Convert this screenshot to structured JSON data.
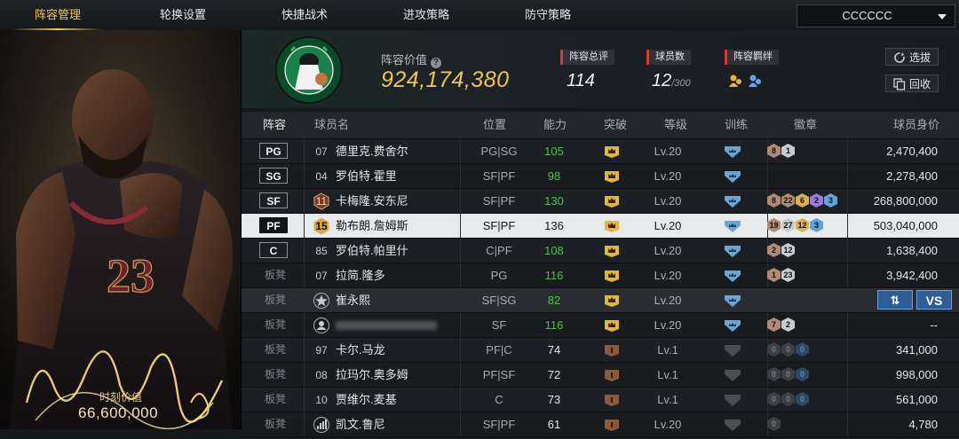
{
  "nav": {
    "tabs": [
      "阵容管理",
      "轮换设置",
      "快捷战术",
      "进攻策略",
      "防守策略"
    ],
    "active_tab": 0,
    "team_select": "CCCCCC"
  },
  "card": {
    "signature_label": "时刻价值",
    "signature_value": "66,600,000",
    "jersey_number": "23"
  },
  "summary": {
    "value_label": "阵容价值",
    "value": "924,174,380",
    "rating_label": "阵容总评",
    "rating": "114",
    "count_label": "球员数",
    "count": "12",
    "count_max": "/300",
    "bond_label": "阵容羁绊",
    "select_button": "选拔",
    "recycle_button": "回收"
  },
  "table": {
    "headers": [
      "阵容",
      "球员名",
      "位置",
      "能力",
      "突破",
      "等级",
      "训练",
      "徽章",
      "球员身价"
    ],
    "rows": [
      {
        "slot": "PG",
        "slot_type": "starter",
        "num": "07",
        "num_style": "plain",
        "name": "德里克.费舍尔",
        "pos": "PG|SG",
        "ability": "105",
        "green": true,
        "break": "gold",
        "level": "Lv.20",
        "train": "blue",
        "badges": [
          {
            "t": "bronze",
            "v": "8"
          },
          {
            "t": "silver",
            "v": "1"
          }
        ],
        "price": "2,470,400"
      },
      {
        "slot": "SG",
        "slot_type": "starter",
        "num": "04",
        "num_style": "plain",
        "name": "罗伯特.霍里",
        "pos": "SF|PF",
        "ability": "98",
        "green": true,
        "break": "gold",
        "level": "Lv.20",
        "train": "blue",
        "badges": [],
        "price": "2,278,400"
      },
      {
        "slot": "SF",
        "slot_type": "starter",
        "num": "11",
        "num_style": "hex",
        "name": "卡梅隆.安东尼",
        "pos": "SF|PF",
        "ability": "130",
        "green": true,
        "break": "gold",
        "level": "Lv.20",
        "train": "blue",
        "badges": [
          {
            "t": "bronze",
            "v": "8"
          },
          {
            "t": "bronze",
            "v": "22"
          },
          {
            "t": "gold",
            "v": "6"
          },
          {
            "t": "purple",
            "v": "2"
          },
          {
            "t": "blue",
            "v": "3"
          }
        ],
        "price": "268,800,000"
      },
      {
        "slot": "PF",
        "slot_type": "starter",
        "num": "15",
        "num_style": "hexgold",
        "name": "勒布朗.詹姆斯",
        "pos": "SF|PF",
        "ability": "136",
        "green": false,
        "break": "gold",
        "level": "Lv.20",
        "train": "blue",
        "badges": [
          {
            "t": "bronze",
            "v": "19"
          },
          {
            "t": "silver",
            "v": "27"
          },
          {
            "t": "gold",
            "v": "12"
          },
          {
            "t": "blue",
            "v": "3"
          }
        ],
        "price": "503,040,000",
        "selected": true
      },
      {
        "slot": "C",
        "slot_type": "starter",
        "num": "85",
        "num_style": "plain",
        "name": "罗伯特.帕里什",
        "pos": "C|PF",
        "ability": "108",
        "green": true,
        "break": "gold",
        "level": "Lv.20",
        "train": "blue",
        "badges": [
          {
            "t": "bronze",
            "v": "2"
          },
          {
            "t": "silver",
            "v": "12"
          }
        ],
        "price": "1,638,400"
      },
      {
        "slot": "板凳",
        "slot_type": "bench",
        "num": "07",
        "num_style": "plain",
        "name": "拉简.隆多",
        "pos": "PG",
        "ability": "116",
        "green": true,
        "break": "gold",
        "level": "Lv.20",
        "train": "blue",
        "badges": [
          {
            "t": "bronze",
            "v": "1"
          },
          {
            "t": "silver",
            "v": "23"
          }
        ],
        "price": "3,942,400"
      },
      {
        "slot": "板凳",
        "slot_type": "bench",
        "num": "★",
        "num_style": "star",
        "name": "崔永熙",
        "pos": "SF|SG",
        "ability": "82",
        "green": true,
        "break": "gold",
        "level": "Lv.20",
        "train": "blue",
        "badges": [],
        "price": "",
        "highlight": true,
        "swap_button": "⇅",
        "vs_button": "VS"
      },
      {
        "slot": "板凳",
        "slot_type": "bench",
        "num": "",
        "num_style": "person",
        "name": "",
        "blurred": true,
        "pos": "SF",
        "ability": "116",
        "green": true,
        "break": "gold",
        "level": "Lv.20",
        "train": "blue",
        "badges": [
          {
            "t": "bronze",
            "v": "7"
          },
          {
            "t": "silver",
            "v": "2"
          }
        ],
        "price": "--"
      },
      {
        "slot": "板凳",
        "slot_type": "bench",
        "num": "97",
        "num_style": "plain",
        "name": "卡尔.马龙",
        "pos": "PF|C",
        "ability": "74",
        "green": false,
        "break": "bronze",
        "level": "Lv.1",
        "train": "grey",
        "badges": [
          {
            "t": "empty",
            "v": "0"
          },
          {
            "t": "empty",
            "v": "0"
          },
          {
            "t": "emptyb",
            "v": "0"
          }
        ],
        "price": "341,000"
      },
      {
        "slot": "板凳",
        "slot_type": "bench",
        "num": "08",
        "num_style": "plain",
        "name": "拉玛尔.奥多姆",
        "pos": "PF|SF",
        "ability": "72",
        "green": false,
        "break": "bronze",
        "level": "Lv.1",
        "train": "grey",
        "badges": [
          {
            "t": "empty",
            "v": "0"
          },
          {
            "t": "empty",
            "v": "0"
          },
          {
            "t": "emptyb",
            "v": "0"
          }
        ],
        "price": "998,000"
      },
      {
        "slot": "板凳",
        "slot_type": "bench",
        "num": "10",
        "num_style": "plain",
        "name": "贾维尔.麦基",
        "pos": "C",
        "ability": "73",
        "green": false,
        "break": "bronze",
        "level": "Lv.1",
        "train": "grey",
        "badges": [
          {
            "t": "empty",
            "v": "0"
          },
          {
            "t": "empty",
            "v": "0"
          },
          {
            "t": "emptyb",
            "v": "0"
          }
        ],
        "price": "561,000"
      },
      {
        "slot": "板凳",
        "slot_type": "bench",
        "num": "",
        "num_style": "bars",
        "name": "凯文.鲁尼",
        "pos": "SF|PF",
        "ability": "61",
        "green": false,
        "break": "bronze",
        "level": "Lv.20",
        "train": "grey",
        "badges": [
          {
            "t": "empty",
            "v": "0"
          }
        ],
        "price": "4,780"
      }
    ]
  },
  "colors": {
    "accent": "#f3c94b",
    "green": "#4ec24e",
    "select_row": "#e8e9ea",
    "vs_blue": "#2c5d95"
  }
}
